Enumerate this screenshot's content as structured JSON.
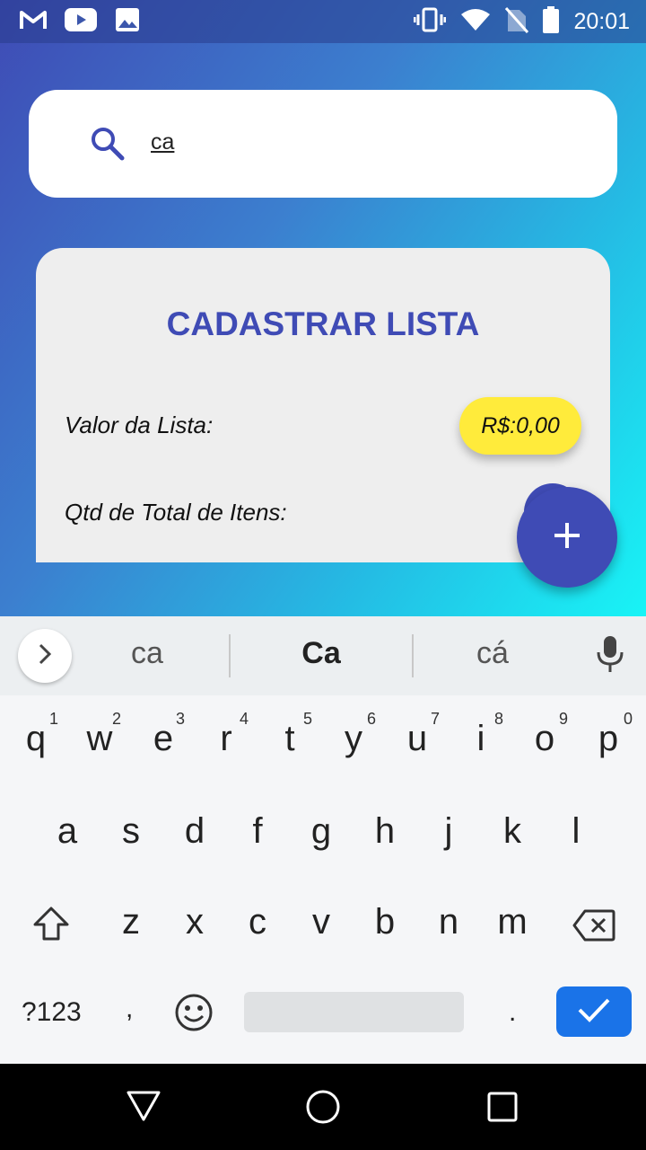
{
  "status_bar": {
    "time": "20:01",
    "left_icons": [
      "gmail-icon",
      "youtube-icon",
      "image-icon"
    ],
    "right_icons": [
      "vibrate-icon",
      "wifi-icon",
      "no-sim-icon",
      "battery-icon"
    ]
  },
  "search": {
    "value": "ca",
    "icon": "search-icon"
  },
  "card": {
    "title": "CADASTRAR LISTA",
    "value_label": "Valor da Lista:",
    "value_amount": "R$:0,00",
    "qty_label": "Qtd de Total de Itens:"
  },
  "fab": {
    "icon": "plus-icon"
  },
  "keyboard": {
    "suggestions": [
      "ca",
      "Ca",
      "cá"
    ],
    "row1": [
      "q",
      "w",
      "e",
      "r",
      "t",
      "y",
      "u",
      "i",
      "o",
      "p"
    ],
    "row1_hints": [
      "1",
      "2",
      "3",
      "4",
      "5",
      "6",
      "7",
      "8",
      "9",
      "0"
    ],
    "row2": [
      "a",
      "s",
      "d",
      "f",
      "g",
      "h",
      "j",
      "k",
      "l"
    ],
    "row3": [
      "z",
      "x",
      "c",
      "v",
      "b",
      "n",
      "m"
    ],
    "symbols_label": "?123",
    "comma": ",",
    "period": "."
  },
  "colors": {
    "accent": "#3f4bb5",
    "chip": "#ffeb3b",
    "enter": "#1a73e8"
  }
}
